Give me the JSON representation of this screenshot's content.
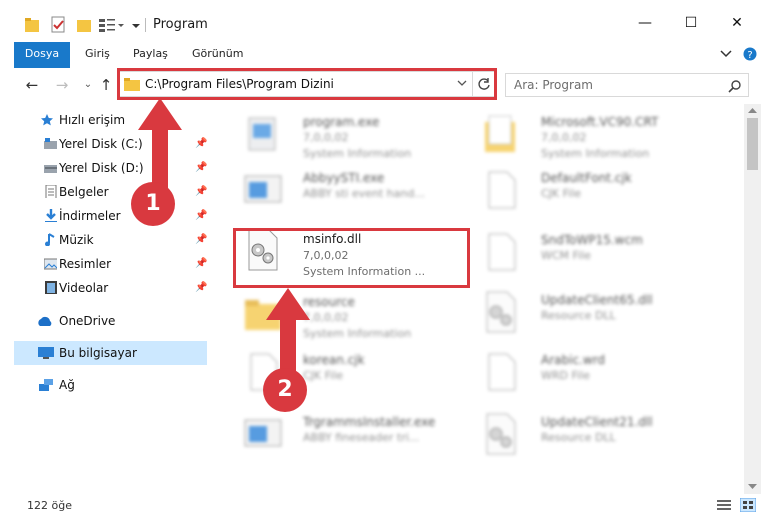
{
  "window": {
    "title": "Program",
    "controls": {
      "minimize": "—",
      "maximize": "☐",
      "close": "✕"
    }
  },
  "ribbon": {
    "tabs": [
      "Dosya",
      "Giriş",
      "Paylaş",
      "Görünüm"
    ]
  },
  "address": {
    "path": "C:\\Program Files\\Program Dizini",
    "search_placeholder": "Ara: Program"
  },
  "sidebar": {
    "quick_access": "Hızlı erişim",
    "items": [
      {
        "label": "Yerel Disk (C:)",
        "icon": "drive-icon",
        "pinned": true
      },
      {
        "label": "Yerel Disk (D:)",
        "icon": "drive-icon",
        "pinned": true
      },
      {
        "label": "Belgeler",
        "icon": "documents-icon",
        "pinned": true
      },
      {
        "label": "İndirmeler",
        "icon": "download-icon",
        "pinned": true
      },
      {
        "label": "Müzik",
        "icon": "music-icon",
        "pinned": true
      },
      {
        "label": "Resimler",
        "icon": "pictures-icon",
        "pinned": true
      },
      {
        "label": "Videolar",
        "icon": "videos-icon",
        "pinned": true
      }
    ],
    "onedrive": "OneDrive",
    "this_pc": "Bu bilgisayar",
    "network": "Ağ"
  },
  "files": {
    "left": [
      {
        "name": "program.exe",
        "ver": "7,0,0,02",
        "desc": "System Information",
        "icon": "exe-icon"
      },
      {
        "name": "AbbyySTI.exe",
        "ver": "ABBY sti event hand...",
        "desc": "",
        "icon": "app-window-icon"
      },
      {
        "name": "msinfo.dll",
        "ver": "7,0,0,02",
        "desc": "System Information ...",
        "icon": "dll-gear-icon"
      },
      {
        "name": "resource",
        "ver": "7,0,0,02",
        "desc": "System Information",
        "icon": "folder-icon"
      },
      {
        "name": "korean.cjk",
        "ver": "CJK File",
        "desc": "",
        "icon": "blank-file-icon"
      },
      {
        "name": "TrgrammsInstaller.exe",
        "ver": "ABBY fineseader tri...",
        "desc": "",
        "icon": "app-window-icon"
      }
    ],
    "right": [
      {
        "name": "Microsoft.VC90.CRT",
        "ver": "7,0,0,02",
        "desc": "System Information",
        "icon": "folder-icon"
      },
      {
        "name": "DefaultFont.cjk",
        "ver": "CJK File",
        "desc": "",
        "icon": "blank-file-icon"
      },
      {
        "name": "SndToWP15.wcm",
        "ver": "WCM File",
        "desc": "",
        "icon": "blank-file-icon"
      },
      {
        "name": "UpdateClient65.dll",
        "ver": "Resource DLL",
        "desc": "",
        "icon": "dll-gear-icon"
      },
      {
        "name": "Arabic.wrd",
        "ver": "WRD File",
        "desc": "",
        "icon": "blank-file-icon"
      },
      {
        "name": "UpdateClient21.dll",
        "ver": "Resource DLL",
        "desc": "",
        "icon": "dll-gear-icon"
      }
    ]
  },
  "annotations": {
    "badge1": "1",
    "badge2": "2"
  },
  "status": {
    "count": "122 öğe"
  },
  "colors": {
    "accent": "#1979ca",
    "highlight": "#d9393f",
    "selection": "#cce8ff"
  }
}
